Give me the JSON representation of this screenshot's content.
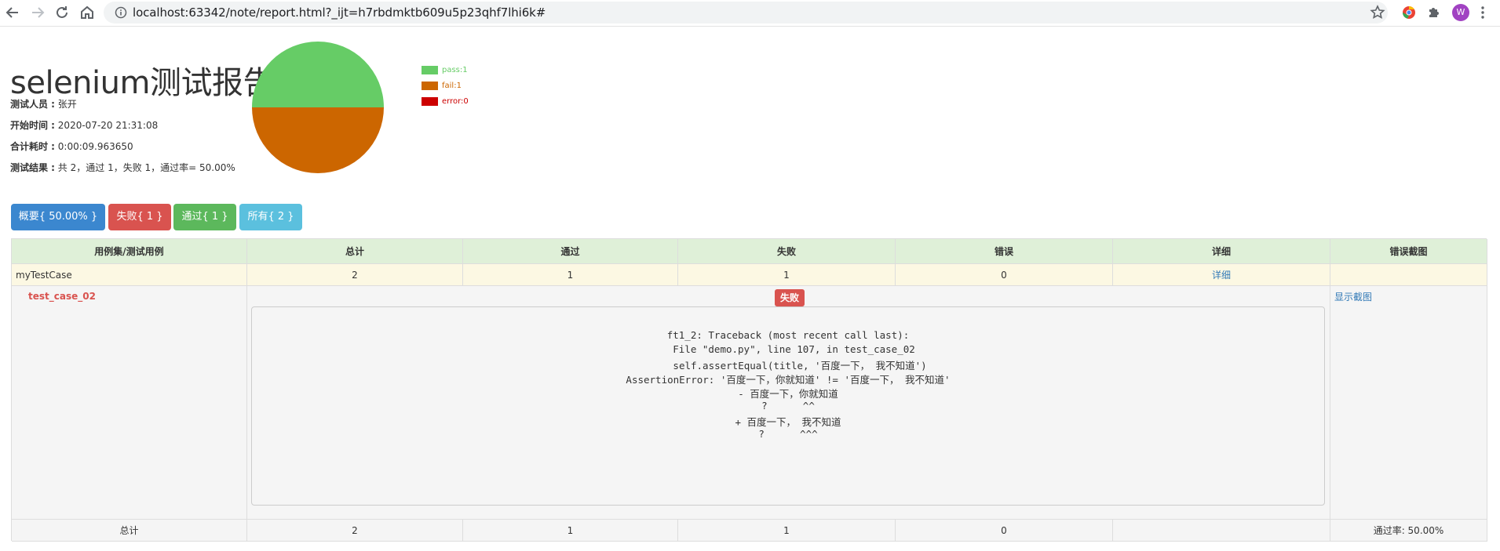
{
  "browser": {
    "url": "localhost:63342/note/report.html?_ijt=h7rbdmktb609u5p23qhf7lhi6k#",
    "avatar_letter": "W"
  },
  "report": {
    "title": "selenium测试报告",
    "attrs": [
      {
        "label": "测试人员 :",
        "value": " 张开"
      },
      {
        "label": "开始时间 :",
        "value": " 2020-07-20 21:31:08"
      },
      {
        "label": "合计耗时 :",
        "value": " 0:00:09.963650"
      },
      {
        "label": "测试结果 :",
        "value": " 共 2，通过 1，失败 1，通过率= 50.00%"
      }
    ]
  },
  "chart_data": {
    "type": "pie",
    "labels": [
      "pass",
      "fail",
      "error"
    ],
    "values": [
      1,
      1,
      0
    ],
    "legend": [
      "pass:1",
      "fail:1",
      "error:0"
    ],
    "colors": [
      "#66cc66",
      "#cc6600",
      "#cc0000"
    ],
    "legend_position": "right"
  },
  "filters": {
    "summary": "概要{ 50.00% }",
    "failed": "失败{ 1 }",
    "passed": "通过{ 1 }",
    "all": "所有{ 2 }"
  },
  "table": {
    "headers": [
      "用例集/测试用例",
      "总计",
      "通过",
      "失败",
      "错误",
      "详细",
      "错误截图"
    ],
    "suite_row": {
      "name": "myTestCase",
      "total": "2",
      "pass": "1",
      "fail": "1",
      "error": "0",
      "detail": "详细"
    },
    "case_row": {
      "name": "test_case_02",
      "status": "失败",
      "screenshot_link": "显示截图",
      "traceback": [
        "ft1_2: Traceback (most recent call last):",
        "  File \"demo.py\", line 107, in test_case_02",
        "    self.assertEqual(title, '百度一下， 我不知道')",
        "AssertionError: '百度一下，你就知道' != '百度一下， 我不知道'",
        "- 百度一下，你就知道",
        "?      ^^",
        "+ 百度一下， 我不知道",
        "?      ^^^"
      ]
    },
    "footer": {
      "label": "总计",
      "total": "2",
      "pass": "1",
      "fail": "1",
      "error": "0",
      "rate": "通过率: 50.00%"
    }
  }
}
